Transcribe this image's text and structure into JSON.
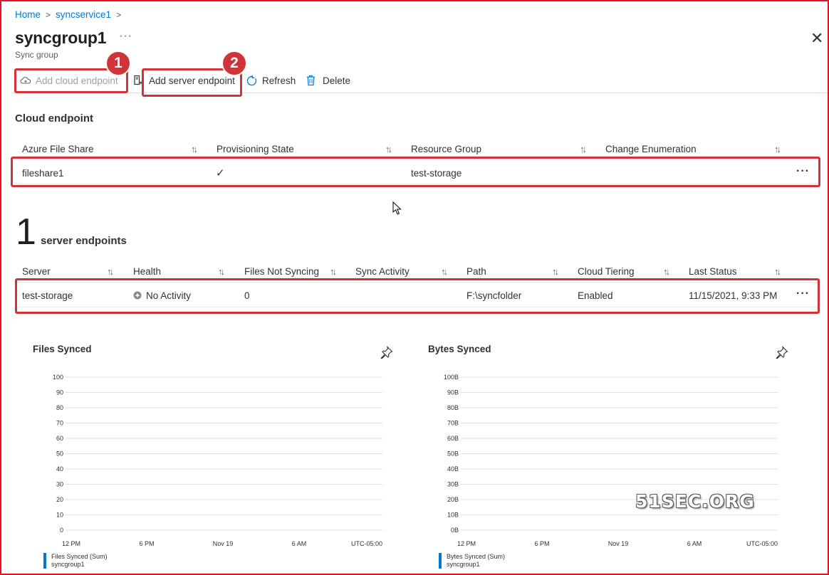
{
  "breadcrumb": [
    {
      "label": "Home"
    },
    {
      "label": "syncservice1"
    }
  ],
  "page": {
    "title": "syncgroup1",
    "subtitle": "Sync group",
    "more": "···"
  },
  "toolbar": {
    "add_cloud": "Add cloud endpoint",
    "add_server": "Add server endpoint",
    "refresh": "Refresh",
    "delete": "Delete"
  },
  "annotations": {
    "badge1": "1",
    "badge2": "2"
  },
  "cloud": {
    "heading": "Cloud endpoint",
    "columns": [
      "Azure File Share",
      "Provisioning State",
      "Resource Group",
      "Change Enumeration"
    ],
    "row": {
      "share": "fileshare1",
      "state": "✓",
      "group": "test-storage",
      "enum": ""
    }
  },
  "server": {
    "count": "1",
    "heading": "server endpoints",
    "columns": [
      "Server",
      "Health",
      "Files Not Syncing",
      "Sync Activity",
      "Path",
      "Cloud Tiering",
      "Last Status"
    ],
    "row": {
      "server": "test-storage",
      "health": "No Activity",
      "files_not_syncing": "0",
      "sync_activity": "",
      "path": "F:\\syncfolder",
      "tiering": "Enabled",
      "last_status": "11/15/2021, 9:33 PM"
    }
  },
  "chart_data": [
    {
      "type": "line",
      "title": "Files Synced",
      "yticks": [
        "100",
        "90",
        "80",
        "70",
        "60",
        "50",
        "40",
        "30",
        "20",
        "10",
        "0"
      ],
      "ylim": [
        0,
        100
      ],
      "xticks": [
        "12 PM",
        "6 PM",
        "Nov 19",
        "6 AM"
      ],
      "timezone": "UTC-05:00",
      "series": [],
      "legend": {
        "metric": "Files Synced (Sum)",
        "resource": "syncgroup1"
      },
      "grid": true
    },
    {
      "type": "line",
      "title": "Bytes Synced",
      "yticks": [
        "100B",
        "90B",
        "80B",
        "70B",
        "60B",
        "50B",
        "40B",
        "30B",
        "20B",
        "10B",
        "0B"
      ],
      "ylim": [
        0,
        100
      ],
      "xticks": [
        "12 PM",
        "6 PM",
        "Nov 19",
        "6 AM"
      ],
      "timezone": "UTC-05:00",
      "series": [],
      "legend": {
        "metric": "Bytes Synced (Sum)",
        "resource": "syncgroup1"
      },
      "grid": true
    }
  ],
  "watermark": "51SEC.ORG",
  "colors": {
    "accent": "#0078d4",
    "annotation": "#d13438",
    "frame": "#e81123"
  }
}
